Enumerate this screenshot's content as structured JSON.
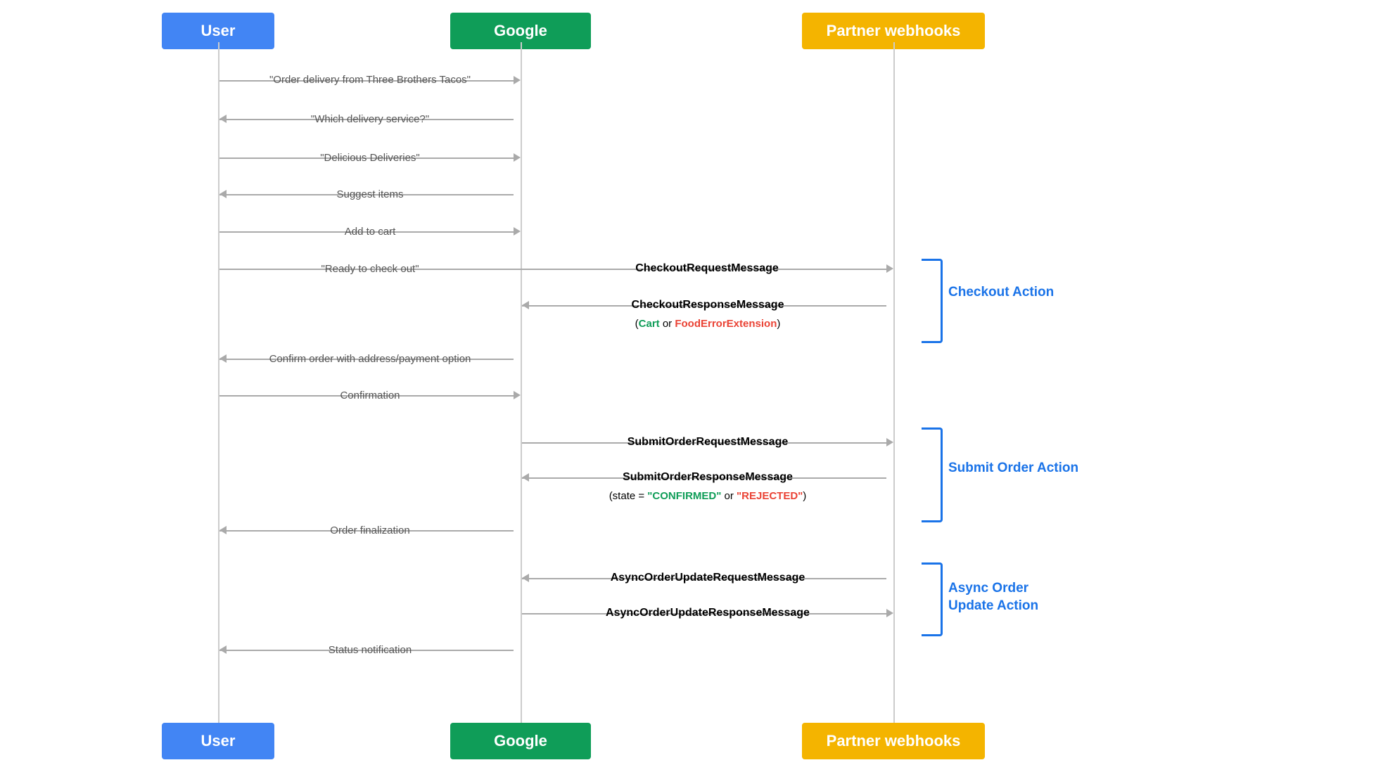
{
  "actors": {
    "user": {
      "label": "User",
      "color": "#4285F4"
    },
    "google": {
      "label": "Google",
      "color": "#0F9D58"
    },
    "partner": {
      "label": "Partner webhooks",
      "color": "#F4B400"
    }
  },
  "messages": [
    {
      "id": "msg1",
      "text": "\"Order delivery from Three Brothers Tacos\"",
      "direction": "right",
      "from": "user",
      "to": "google",
      "bold": false
    },
    {
      "id": "msg2",
      "text": "\"Which delivery service?\"",
      "direction": "left",
      "from": "google",
      "to": "user",
      "bold": false
    },
    {
      "id": "msg3",
      "text": "\"Delicious Deliveries\"",
      "direction": "right",
      "from": "user",
      "to": "google",
      "bold": false
    },
    {
      "id": "msg4",
      "text": "Suggest items",
      "direction": "left",
      "from": "google",
      "to": "user",
      "bold": false
    },
    {
      "id": "msg5",
      "text": "Add to cart",
      "direction": "right",
      "from": "user",
      "to": "google",
      "bold": false
    },
    {
      "id": "msg6",
      "text": "\"Ready to check out\"",
      "direction": "right",
      "from": "user",
      "to": "google",
      "bold": false
    },
    {
      "id": "msg6b",
      "text": "CheckoutRequestMessage",
      "direction": "right",
      "from": "google",
      "to": "partner",
      "bold": true
    },
    {
      "id": "msg7",
      "text": "CheckoutResponseMessage",
      "direction": "left",
      "from": "partner",
      "to": "google",
      "bold": true
    },
    {
      "id": "msg7b",
      "text": "(Cart or FoodErrorExtension)",
      "direction": "none",
      "bold": false,
      "sub": true,
      "parts": [
        "(",
        "Cart",
        " or ",
        "FoodErrorExtension",
        ")"
      ]
    },
    {
      "id": "msg8",
      "text": "Confirm order with address/payment option",
      "direction": "left",
      "from": "google",
      "to": "user",
      "bold": false
    },
    {
      "id": "msg9",
      "text": "Confirmation",
      "direction": "right",
      "from": "user",
      "to": "google",
      "bold": false
    },
    {
      "id": "msg10",
      "text": "SubmitOrderRequestMessage",
      "direction": "right",
      "from": "google",
      "to": "partner",
      "bold": true
    },
    {
      "id": "msg11",
      "text": "SubmitOrderResponseMessage",
      "direction": "left",
      "from": "partner",
      "to": "google",
      "bold": true
    },
    {
      "id": "msg11b",
      "text": "(state = \"CONFIRMED\" or \"REJECTED\")",
      "direction": "none",
      "bold": false,
      "sub": true
    },
    {
      "id": "msg12",
      "text": "Order finalization",
      "direction": "left",
      "from": "google",
      "to": "user",
      "bold": false
    },
    {
      "id": "msg13",
      "text": "AsyncOrderUpdateRequestMessage",
      "direction": "left",
      "from": "partner",
      "to": "google",
      "bold": true
    },
    {
      "id": "msg14",
      "text": "AsyncOrderUpdateResponseMessage",
      "direction": "right",
      "from": "google",
      "to": "partner",
      "bold": true
    },
    {
      "id": "msg15",
      "text": "Status notification",
      "direction": "left",
      "from": "google",
      "to": "user",
      "bold": false
    }
  ],
  "brackets": [
    {
      "id": "checkout",
      "label": "Checkout Action"
    },
    {
      "id": "submit",
      "label": "Submit Order Action"
    },
    {
      "id": "async",
      "label1": "Async Order",
      "label2": "Update Action"
    }
  ]
}
